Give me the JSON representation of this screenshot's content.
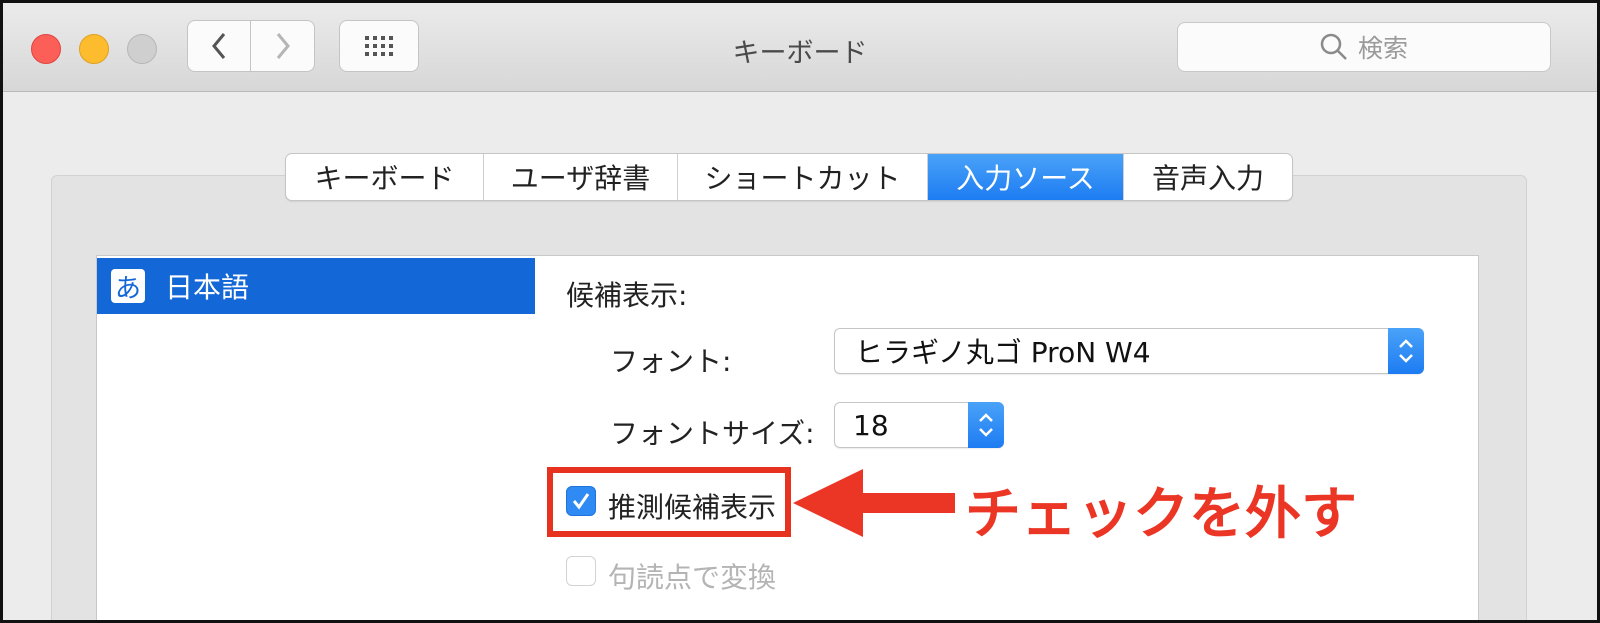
{
  "window": {
    "title": "キーボード"
  },
  "search": {
    "placeholder": "検索"
  },
  "tabs": [
    {
      "label": "キーボード",
      "active": false
    },
    {
      "label": "ユーザ辞書",
      "active": false
    },
    {
      "label": "ショートカット",
      "active": false
    },
    {
      "label": "入力ソース",
      "active": true
    },
    {
      "label": "音声入力",
      "active": false
    }
  ],
  "source_list": [
    {
      "icon": "あ",
      "label": "日本語",
      "selected": true
    }
  ],
  "detail": {
    "section_label": "候補表示:",
    "font_label": "フォント:",
    "font_value": "ヒラギノ丸ゴ ProN W4",
    "font_size_label": "フォントサイズ:",
    "font_size_value": "18",
    "predictive_label": "推測候補表示",
    "predictive_checked": true,
    "punctuation_label": "句読点で変換",
    "punctuation_checked": false,
    "punctuation_enabled": false
  },
  "annotation": {
    "text": "チェックを外す",
    "color": "#ec3625"
  },
  "colors": {
    "accent": "#1d7cf2",
    "selection": "#1367d6",
    "close": "#fc5f57",
    "minimize": "#fdbc2e",
    "zoom": "#cfcfcf"
  }
}
